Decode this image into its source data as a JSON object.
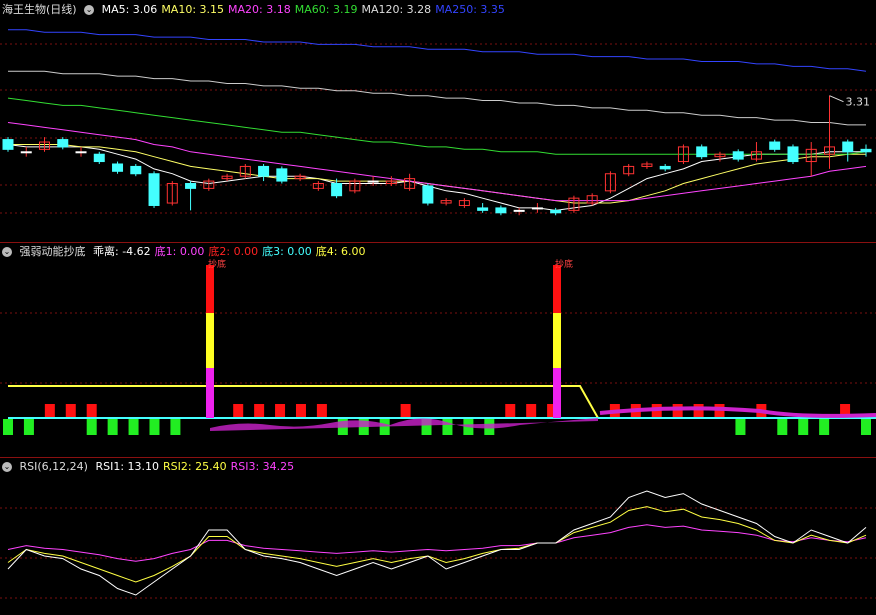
{
  "main": {
    "title": "海王生物(日线)",
    "ma": [
      {
        "label": "MA5: 3.06",
        "color": "#ffffff"
      },
      {
        "label": "MA10: 3.15",
        "color": "#ffff66"
      },
      {
        "label": "MA20: 3.18",
        "color": "#ff44ff"
      },
      {
        "label": "MA60: 3.19",
        "color": "#33dd33"
      },
      {
        "label": "MA120: 3.28",
        "color": "#dddddd"
      },
      {
        "label": "MA250: 3.35",
        "color": "#3344ff"
      }
    ],
    "high_marker": "3.31",
    "candles": [
      {
        "o": 3.13,
        "c": 3.09,
        "h": 3.14,
        "l": 3.08
      },
      {
        "o": 3.08,
        "c": 3.08,
        "h": 3.1,
        "l": 3.06
      },
      {
        "o": 3.09,
        "c": 3.12,
        "h": 3.14,
        "l": 3.08
      },
      {
        "o": 3.13,
        "c": 3.1,
        "h": 3.14,
        "l": 3.09
      },
      {
        "o": 3.08,
        "c": 3.08,
        "h": 3.1,
        "l": 3.06
      },
      {
        "o": 3.07,
        "c": 3.04,
        "h": 3.08,
        "l": 3.03
      },
      {
        "o": 3.03,
        "c": 3.0,
        "h": 3.04,
        "l": 2.99
      },
      {
        "o": 3.02,
        "c": 2.99,
        "h": 3.03,
        "l": 2.98
      },
      {
        "o": 2.99,
        "c": 2.86,
        "h": 3.0,
        "l": 2.85
      },
      {
        "o": 2.87,
        "c": 2.95,
        "h": 2.96,
        "l": 2.86
      },
      {
        "o": 2.95,
        "c": 2.93,
        "h": 2.96,
        "l": 2.84
      },
      {
        "o": 2.93,
        "c": 2.96,
        "h": 2.97,
        "l": 2.92
      },
      {
        "o": 2.97,
        "c": 2.98,
        "h": 2.99,
        "l": 2.96
      },
      {
        "o": 2.98,
        "c": 3.02,
        "h": 3.03,
        "l": 2.97
      },
      {
        "o": 3.02,
        "c": 2.98,
        "h": 3.03,
        "l": 2.96
      },
      {
        "o": 3.01,
        "c": 2.96,
        "h": 3.02,
        "l": 2.95
      },
      {
        "o": 2.97,
        "c": 2.98,
        "h": 2.99,
        "l": 2.96
      },
      {
        "o": 2.93,
        "c": 2.95,
        "h": 2.96,
        "l": 2.92
      },
      {
        "o": 2.95,
        "c": 2.9,
        "h": 2.97,
        "l": 2.89
      },
      {
        "o": 2.92,
        "c": 2.96,
        "h": 2.97,
        "l": 2.91
      },
      {
        "o": 2.96,
        "c": 2.96,
        "h": 2.98,
        "l": 2.94
      },
      {
        "o": 2.95,
        "c": 2.96,
        "h": 2.98,
        "l": 2.94
      },
      {
        "o": 2.93,
        "c": 2.97,
        "h": 2.99,
        "l": 2.92
      },
      {
        "o": 2.94,
        "c": 2.87,
        "h": 2.95,
        "l": 2.86
      },
      {
        "o": 2.87,
        "c": 2.88,
        "h": 2.89,
        "l": 2.86
      },
      {
        "o": 2.86,
        "c": 2.88,
        "h": 2.89,
        "l": 2.85
      },
      {
        "o": 2.85,
        "c": 2.84,
        "h": 2.87,
        "l": 2.83
      },
      {
        "o": 2.85,
        "c": 2.83,
        "h": 2.86,
        "l": 2.82
      },
      {
        "o": 2.84,
        "c": 2.84,
        "h": 2.85,
        "l": 2.82
      },
      {
        "o": 2.85,
        "c": 2.85,
        "h": 2.87,
        "l": 2.83
      },
      {
        "o": 2.84,
        "c": 2.83,
        "h": 2.85,
        "l": 2.82
      },
      {
        "o": 2.84,
        "c": 2.89,
        "h": 2.9,
        "l": 2.83
      },
      {
        "o": 2.87,
        "c": 2.9,
        "h": 2.91,
        "l": 2.86
      },
      {
        "o": 2.92,
        "c": 2.99,
        "h": 3.0,
        "l": 2.91
      },
      {
        "o": 2.99,
        "c": 3.02,
        "h": 3.03,
        "l": 2.98
      },
      {
        "o": 3.02,
        "c": 3.03,
        "h": 3.04,
        "l": 3.01
      },
      {
        "o": 3.02,
        "c": 3.01,
        "h": 3.03,
        "l": 3.0
      },
      {
        "o": 3.04,
        "c": 3.1,
        "h": 3.11,
        "l": 3.03
      },
      {
        "o": 3.1,
        "c": 3.06,
        "h": 3.11,
        "l": 3.05
      },
      {
        "o": 3.06,
        "c": 3.07,
        "h": 3.08,
        "l": 3.04
      },
      {
        "o": 3.08,
        "c": 3.05,
        "h": 3.09,
        "l": 3.04
      },
      {
        "o": 3.05,
        "c": 3.08,
        "h": 3.12,
        "l": 3.04
      },
      {
        "o": 3.12,
        "c": 3.09,
        "h": 3.13,
        "l": 3.08
      },
      {
        "o": 3.1,
        "c": 3.04,
        "h": 3.11,
        "l": 3.03
      },
      {
        "o": 3.04,
        "c": 3.09,
        "h": 3.12,
        "l": 2.98
      },
      {
        "o": 3.07,
        "c": 3.1,
        "h": 3.31,
        "l": 3.01
      },
      {
        "o": 3.12,
        "c": 3.08,
        "h": 3.13,
        "l": 3.04
      },
      {
        "o": 3.09,
        "c": 3.08,
        "h": 3.11,
        "l": 3.06
      }
    ],
    "ma_series": {
      "ma5": [
        3.11,
        3.1,
        3.1,
        3.1,
        3.1,
        3.09,
        3.07,
        3.05,
        3.01,
        2.99,
        2.96,
        2.95,
        2.96,
        2.97,
        2.98,
        2.98,
        2.98,
        2.97,
        2.95,
        2.95,
        2.95,
        2.95,
        2.96,
        2.94,
        2.92,
        2.91,
        2.89,
        2.87,
        2.85,
        2.85,
        2.84,
        2.85,
        2.86,
        2.89,
        2.93,
        2.97,
        2.99,
        3.01,
        3.04,
        3.05,
        3.06,
        3.07,
        3.07,
        3.07,
        3.07,
        3.08,
        3.08,
        3.08
      ],
      "ma10": [
        3.11,
        3.11,
        3.11,
        3.11,
        3.1,
        3.1,
        3.09,
        3.08,
        3.06,
        3.04,
        3.02,
        3.01,
        3.0,
        2.99,
        2.98,
        2.97,
        2.97,
        2.97,
        2.96,
        2.96,
        2.96,
        2.96,
        2.96,
        2.95,
        2.94,
        2.93,
        2.92,
        2.91,
        2.9,
        2.89,
        2.88,
        2.87,
        2.87,
        2.87,
        2.88,
        2.9,
        2.92,
        2.95,
        2.97,
        2.99,
        3.01,
        3.03,
        3.04,
        3.05,
        3.06,
        3.06,
        3.07,
        3.07
      ],
      "ma20": [
        3.2,
        3.19,
        3.18,
        3.17,
        3.16,
        3.15,
        3.14,
        3.13,
        3.11,
        3.1,
        3.08,
        3.07,
        3.06,
        3.05,
        3.04,
        3.03,
        3.02,
        3.01,
        3.0,
        2.99,
        2.98,
        2.97,
        2.96,
        2.95,
        2.94,
        2.93,
        2.92,
        2.91,
        2.9,
        2.89,
        2.88,
        2.88,
        2.88,
        2.88,
        2.88,
        2.89,
        2.9,
        2.91,
        2.92,
        2.93,
        2.94,
        2.95,
        2.96,
        2.97,
        2.98,
        3.0,
        3.01,
        3.02
      ],
      "ma60": [
        3.3,
        3.29,
        3.28,
        3.27,
        3.27,
        3.26,
        3.25,
        3.24,
        3.23,
        3.22,
        3.21,
        3.2,
        3.19,
        3.18,
        3.17,
        3.16,
        3.16,
        3.15,
        3.14,
        3.13,
        3.12,
        3.12,
        3.11,
        3.1,
        3.1,
        3.09,
        3.09,
        3.08,
        3.08,
        3.08,
        3.07,
        3.07,
        3.07,
        3.07,
        3.07,
        3.07,
        3.07,
        3.07,
        3.07,
        3.07,
        3.07,
        3.07,
        3.07,
        3.07,
        3.07,
        3.07,
        3.07,
        3.08
      ],
      "ma120": [
        3.41,
        3.41,
        3.41,
        3.4,
        3.4,
        3.4,
        3.39,
        3.39,
        3.38,
        3.38,
        3.37,
        3.37,
        3.36,
        3.36,
        3.35,
        3.35,
        3.34,
        3.34,
        3.33,
        3.33,
        3.32,
        3.32,
        3.31,
        3.31,
        3.3,
        3.3,
        3.29,
        3.29,
        3.28,
        3.28,
        3.27,
        3.27,
        3.26,
        3.26,
        3.25,
        3.25,
        3.24,
        3.24,
        3.23,
        3.23,
        3.22,
        3.22,
        3.21,
        3.21,
        3.2,
        3.2,
        3.19,
        3.19
      ],
      "ma250": [
        3.58,
        3.58,
        3.57,
        3.57,
        3.57,
        3.56,
        3.56,
        3.56,
        3.55,
        3.55,
        3.55,
        3.54,
        3.54,
        3.54,
        3.53,
        3.53,
        3.53,
        3.52,
        3.52,
        3.52,
        3.51,
        3.51,
        3.51,
        3.5,
        3.5,
        3.5,
        3.49,
        3.49,
        3.49,
        3.48,
        3.48,
        3.48,
        3.47,
        3.47,
        3.47,
        3.46,
        3.46,
        3.46,
        3.45,
        3.45,
        3.45,
        3.44,
        3.44,
        3.43,
        3.43,
        3.42,
        3.42,
        3.41
      ]
    }
  },
  "indicator": {
    "title": "强弱动能抄底",
    "items": [
      {
        "label": "乖离: -4.62",
        "color": "#ffffff"
      },
      {
        "label": "底1: 0.00",
        "color": "#ff44ff"
      },
      {
        "label": "底2: 0.00",
        "color": "#ff2222"
      },
      {
        "label": "底3: 0.00",
        "color": "#44ffff"
      },
      {
        "label": "底4: 6.00",
        "color": "#ffff44"
      }
    ],
    "signal_label": "抄底",
    "signal_labels": [
      "抄底",
      "抄底"
    ]
  },
  "rsi": {
    "title": "RSI(6,12,24)",
    "items": [
      {
        "label": "RSI1: 13.10",
        "color": "#ffffff"
      },
      {
        "label": "RSI2: 25.40",
        "color": "#ffff44"
      },
      {
        "label": "RSI3: 34.25",
        "color": "#ff44ff"
      }
    ],
    "rsi1": [
      30,
      45,
      40,
      38,
      30,
      25,
      15,
      10,
      20,
      30,
      40,
      60,
      60,
      45,
      40,
      38,
      35,
      30,
      25,
      30,
      35,
      30,
      35,
      40,
      30,
      35,
      40,
      45,
      45,
      50,
      50,
      60,
      65,
      70,
      85,
      90,
      85,
      88,
      80,
      75,
      70,
      65,
      55,
      50,
      60,
      55,
      50,
      62
    ],
    "rsi2": [
      35,
      45,
      42,
      40,
      35,
      30,
      25,
      20,
      25,
      32,
      40,
      55,
      55,
      45,
      42,
      40,
      38,
      35,
      32,
      35,
      38,
      35,
      38,
      40,
      35,
      38,
      42,
      45,
      46,
      50,
      50,
      58,
      62,
      66,
      75,
      78,
      74,
      76,
      70,
      68,
      65,
      60,
      52,
      50,
      56,
      52,
      50,
      56
    ],
    "rsi3": [
      45,
      48,
      46,
      45,
      43,
      41,
      38,
      36,
      38,
      42,
      45,
      52,
      52,
      48,
      46,
      45,
      44,
      43,
      42,
      43,
      44,
      43,
      44,
      45,
      44,
      45,
      46,
      48,
      48,
      50,
      50,
      54,
      56,
      58,
      62,
      64,
      62,
      63,
      60,
      59,
      58,
      56,
      52,
      51,
      54,
      52,
      51,
      54
    ]
  }
}
